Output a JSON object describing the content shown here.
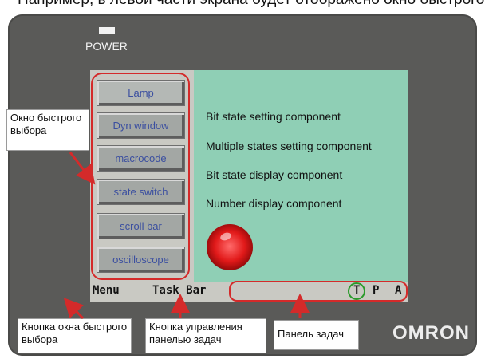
{
  "caption_partial": "Например, в левой части экрана будет отображено окно быстрого выбора",
  "power_label": "POWER",
  "quick_buttons": [
    "Lamp",
    "Dyn window",
    "macrocode",
    "state switch",
    "scroll bar",
    "oscilloscope"
  ],
  "components": [
    "Bit state setting component",
    "Multiple states setting component",
    "Bit state display component",
    "Number display component"
  ],
  "taskbar": {
    "menu": "Menu",
    "taskbar": "Task Bar",
    "t": "T",
    "p": "P",
    "a": "A"
  },
  "callouts": {
    "quick_window": "Окно быстрого выбора",
    "quick_button": "Кнопка окна быстрого выбора",
    "taskbar_control": "Кнопка управления панелью задач",
    "taskbar_panel": "Панель задач"
  },
  "brand": "OMRON",
  "colors": {
    "bezel": "#5a5a58",
    "screen": "#8fcfb5",
    "highlight": "#d42a2a",
    "t_circle": "#2a9a2a"
  }
}
